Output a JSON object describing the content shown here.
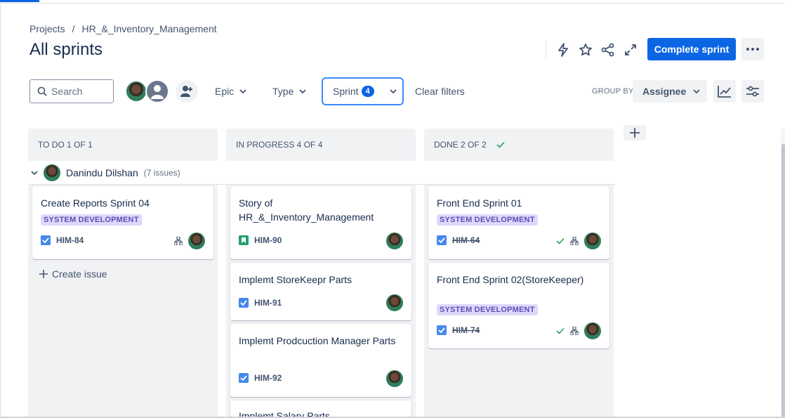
{
  "breadcrumb": {
    "projects": "Projects",
    "separator": "/",
    "project": "HR_&_Inventory_Management"
  },
  "page_title": "All sprints",
  "header_actions": {
    "icons": [
      "lightning-icon",
      "star-icon",
      "share-icon",
      "expand-icon"
    ],
    "complete_sprint": "Complete sprint",
    "more": "more-icon"
  },
  "toolbar": {
    "search_placeholder": "Search",
    "filters": {
      "epic": "Epic",
      "type": "Type",
      "sprint": "Sprint",
      "sprint_count": "4"
    },
    "clear_filters": "Clear filters",
    "group_by_label": "GROUP BY",
    "group_by_value": "Assignee"
  },
  "columns": [
    {
      "label": "TO DO 1 OF 1"
    },
    {
      "label": "IN PROGRESS 4 OF 4"
    },
    {
      "label": "DONE 2 OF 2"
    }
  ],
  "swimlane": {
    "name": "Danindu Dilshan",
    "count": "(7 issues)"
  },
  "cards": {
    "todo": [
      {
        "title": "Create Reports Sprint 04",
        "epic": "SYSTEM DEVELOPMENT",
        "key": "HIM-84"
      }
    ],
    "inprogress": [
      {
        "title": "Story of HR_&_Inventory_Management",
        "key": "HIM-90"
      },
      {
        "title": "Implemt StoreKeepr Parts",
        "key": "HIM-91"
      },
      {
        "title": "Implemt Prodcuction Manager Parts",
        "key": "HIM-92"
      },
      {
        "title": "Implemt Salary Parts"
      }
    ],
    "done": [
      {
        "title": "Front End Sprint 01",
        "epic": "SYSTEM DEVELOPMENT",
        "key": "HIM-64"
      },
      {
        "title": "Front End Sprint 02(StoreKeeper)",
        "epic": "SYSTEM DEVELOPMENT",
        "key": "HIM-74"
      }
    ]
  },
  "create_issue": "Create issue",
  "colors": {
    "primary": "#0c66e4",
    "epic_bg": "#dfd8fd",
    "epic_text": "#5e4db2",
    "task": "#4688ec",
    "story": "#22a06b",
    "done_check": "#22a06b"
  }
}
